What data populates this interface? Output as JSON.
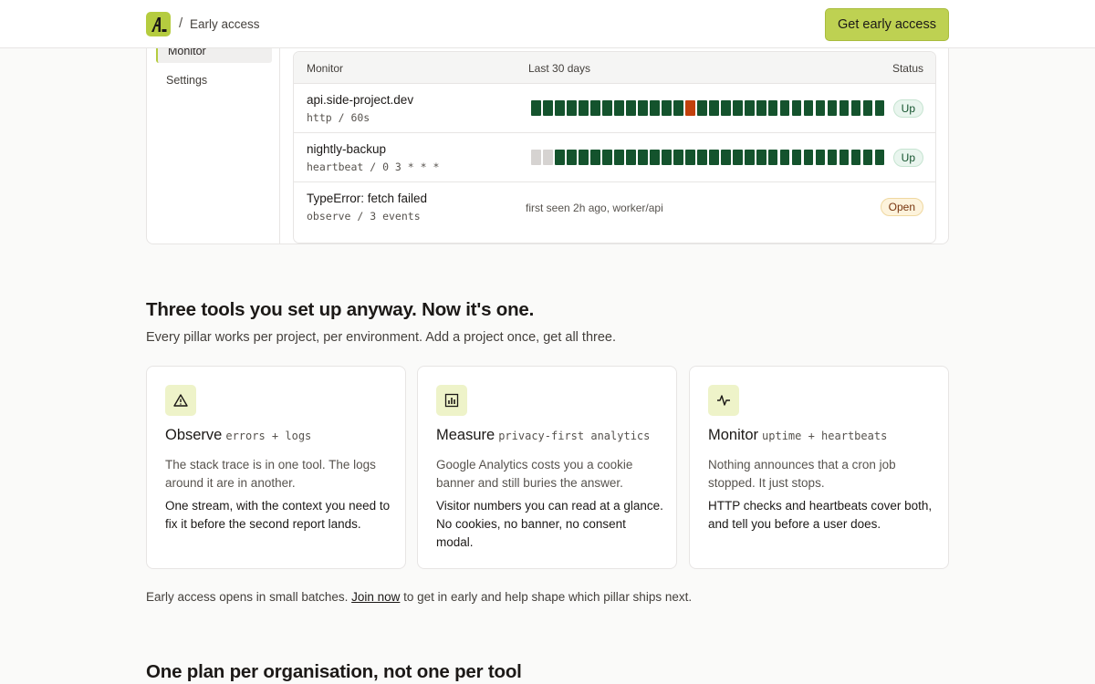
{
  "header": {
    "separator": "/",
    "breadcrumb": "Early access",
    "cta_label": "Get early access"
  },
  "preview": {
    "sidebar": [
      "Monitor",
      "Settings"
    ],
    "table": {
      "headers": {
        "monitor": "Monitor",
        "range": "Last 30 days",
        "status": "Status"
      },
      "rows": [
        {
          "name": "api.side-project.dev",
          "meta": "http / 60s",
          "status": "Up",
          "days": [
            "up",
            "up",
            "up",
            "up",
            "up",
            "up",
            "up",
            "up",
            "up",
            "up",
            "up",
            "up",
            "up",
            "down",
            "up",
            "up",
            "up",
            "up",
            "up",
            "up",
            "up",
            "up",
            "up",
            "up",
            "up",
            "up",
            "up",
            "up",
            "up",
            "up"
          ]
        },
        {
          "name": "nightly-backup",
          "meta": "heartbeat / 0 3 * * *",
          "status": "Up",
          "days": [
            "none",
            "none",
            "up",
            "up",
            "up",
            "up",
            "up",
            "up",
            "up",
            "up",
            "up",
            "up",
            "up",
            "up",
            "up",
            "up",
            "up",
            "up",
            "up",
            "up",
            "up",
            "up",
            "up",
            "up",
            "up",
            "up",
            "up",
            "up",
            "up",
            "up"
          ]
        },
        {
          "name": "TypeError: fetch failed",
          "meta": "observe / 3 events",
          "note": "first seen 2h ago, worker/api",
          "status": "Open"
        }
      ]
    },
    "colors": {
      "up": "#14532d",
      "down": "#c2410c",
      "none": "#d6d3d1"
    }
  },
  "tools": {
    "heading": "Three tools you set up anyway. Now it's one.",
    "subheading": "Every pillar works per project, per environment. Add a project once, get all three.",
    "cards": [
      {
        "icon": "warning-triangle-icon",
        "title": "Observe",
        "tag": "errors + logs",
        "problem": "The stack trace is in one tool. The logs around it are in another.",
        "solution": "One stream, with the context you need to fix it before the second report lands."
      },
      {
        "icon": "bar-chart-icon",
        "title": "Measure",
        "tag": "privacy-first analytics",
        "problem": "Google Analytics costs you a cookie banner and still buries the answer.",
        "solution": "Visitor numbers you can read at a glance. No cookies, no banner, no consent modal."
      },
      {
        "icon": "pulse-icon",
        "title": "Monitor",
        "tag": "uptime + heartbeats",
        "problem": "Nothing announces that a cron job stopped. It just stops.",
        "solution": "HTTP checks and heartbeats cover both, and tell you before a user does."
      }
    ],
    "note_before": "Early access opens in small batches. ",
    "note_link": "Join now",
    "note_after": " to get in early and help shape which pillar ships next."
  },
  "pricing": {
    "heading": "One plan per organisation, not one per tool"
  },
  "accent": "#bed152"
}
